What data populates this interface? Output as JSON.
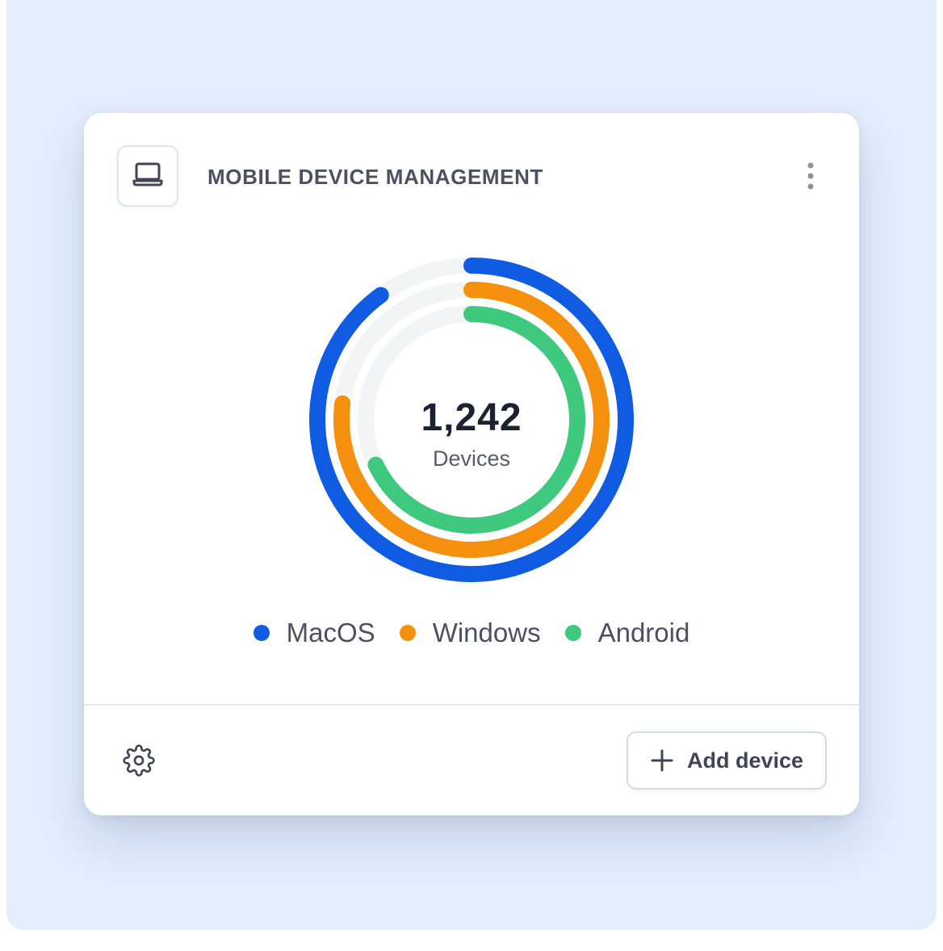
{
  "widget": {
    "title": "MOBILE DEVICE MANAGEMENT",
    "header_icon": "laptop-icon",
    "menu_icon": "more-vertical-icon"
  },
  "summary": {
    "total": "1,242",
    "label": "Devices"
  },
  "chart_data": {
    "type": "radial-bar",
    "track_color": "#f3f4f6",
    "series": [
      {
        "name": "MacOS",
        "fraction": 0.9,
        "color": "#0f5ce3"
      },
      {
        "name": "Windows",
        "fraction": 0.77,
        "color": "#f5900f"
      },
      {
        "name": "Android",
        "fraction": 0.68,
        "color": "#3ec97e"
      }
    ]
  },
  "footer": {
    "settings_icon": "gear-icon",
    "add_button_label": "Add device",
    "add_button_icon": "plus-icon"
  }
}
